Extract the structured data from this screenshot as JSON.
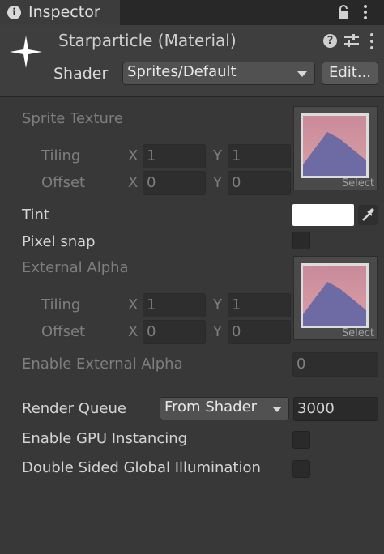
{
  "tab": {
    "title": "Inspector",
    "info_icon": "info-icon",
    "lock_icon": "lock-icon",
    "menu_icon": "kebab-menu-icon"
  },
  "header": {
    "material_title": "Starparticle (Material)",
    "shader_label": "Shader",
    "shader_value": "Sprites/Default",
    "edit_label": "Edit..."
  },
  "properties": {
    "sprite_texture": {
      "label": "Sprite Texture",
      "tiling_label": "Tiling",
      "offset_label": "Offset",
      "x_label": "X",
      "y_label": "Y",
      "tiling_x": "1",
      "tiling_y": "1",
      "offset_x": "0",
      "offset_y": "0",
      "select_label": "Select"
    },
    "tint": {
      "label": "Tint",
      "color": "#ffffff"
    },
    "pixel_snap": {
      "label": "Pixel snap",
      "checked": false
    },
    "external_alpha": {
      "label": "External Alpha",
      "tiling_label": "Tiling",
      "offset_label": "Offset",
      "x_label": "X",
      "y_label": "Y",
      "tiling_x": "1",
      "tiling_y": "1",
      "offset_x": "0",
      "offset_y": "0",
      "select_label": "Select"
    },
    "enable_external_alpha": {
      "label": "Enable External Alpha",
      "value": "0"
    },
    "render_queue": {
      "label": "Render Queue",
      "mode": "From Shader",
      "value": "3000"
    },
    "gpu_instancing": {
      "label": "Enable GPU Instancing",
      "checked": false
    },
    "double_sided_gi": {
      "label": "Double Sided Global Illumination",
      "checked": false
    }
  },
  "colors": {
    "background": "#383838",
    "header": "#3e3e3e",
    "tab_bar": "#282828",
    "field": "#2a2a2a"
  }
}
